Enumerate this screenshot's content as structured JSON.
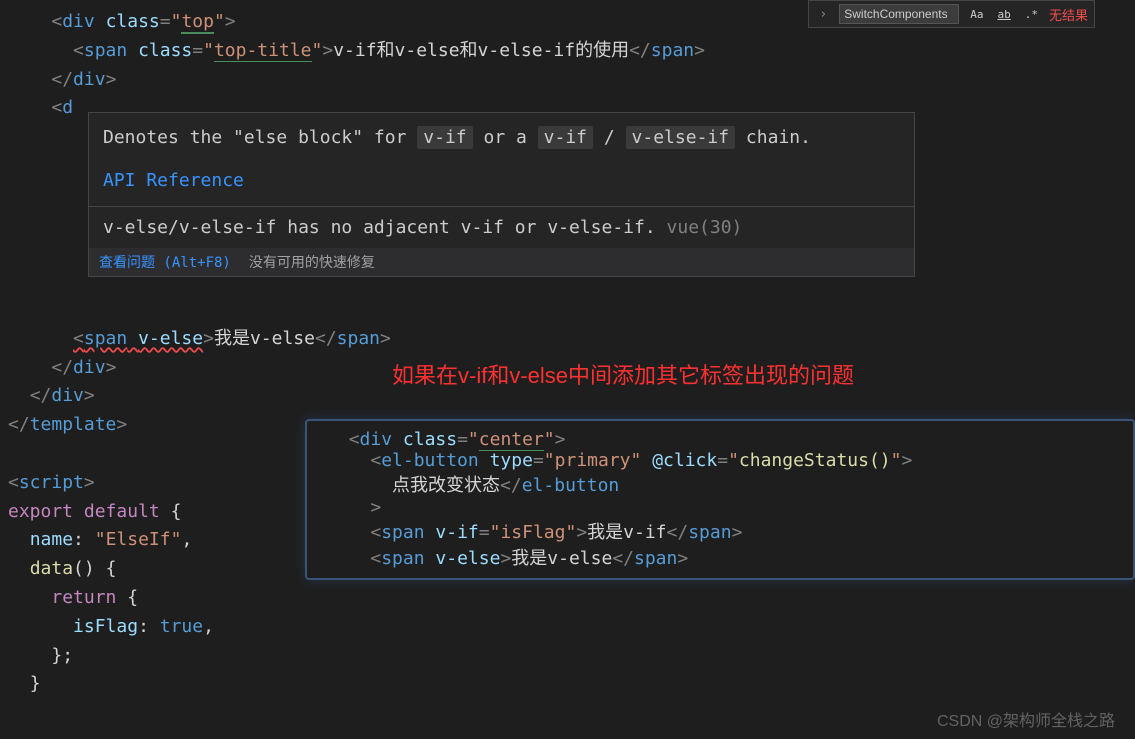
{
  "search": {
    "value": "SwitchComponents",
    "noResult": "无结果",
    "iconCase": "Aa",
    "iconWord": "ab",
    "iconRegex": ".*"
  },
  "code": {
    "l1": {
      "open": "<",
      "tag": "div",
      "attr": "class",
      "eq": "=",
      "q": "\"",
      "val": "top",
      "close": ">"
    },
    "l2": {
      "open": "<",
      "tag": "span",
      "attr": "class",
      "eq": "=",
      "q": "\"",
      "val": "top-title",
      "close": ">",
      "text": "v-if和v-else和v-else-if的使用",
      "open2": "</",
      "close2": ">"
    },
    "l3": {
      "open": "</",
      "tag": "div",
      "close": ">"
    },
    "l4": {
      "open": "<",
      "tag": "d"
    },
    "l5": {
      "open": "<",
      "tag": "span",
      "attr": "v-else",
      "close": ">",
      "text": "我是v-else",
      "open2": "</",
      "close2": ">"
    },
    "l6": {
      "open": "</",
      "tag": "div",
      "close": ">"
    },
    "l7": {
      "open": "</",
      "tag": "div",
      "close": ">"
    },
    "l8": {
      "open": "</",
      "tag": "template",
      "close": ">"
    },
    "l9": {
      "open": "<",
      "tag": "script",
      "close": ">"
    },
    "l10": {
      "kw1": "export",
      "kw2": "default",
      "brace": "{"
    },
    "l11": {
      "var": "name",
      "colon": ": ",
      "q": "\"",
      "val": "ElseIf",
      "comma": ","
    },
    "l12": {
      "fn": "data",
      "paren": "()",
      "brace": " {"
    },
    "l13": {
      "kw": "return",
      "brace": " {"
    },
    "l14": {
      "var": "isFlag",
      "colon": ": ",
      "val": "true",
      "comma": ","
    },
    "l15": {
      "close": "};"
    },
    "l16": {
      "close": "}"
    }
  },
  "hover": {
    "desc1": "Denotes the \"else block\" for ",
    "pill1": "v-if",
    "desc2": " or a ",
    "pill2": "v-if",
    "desc3": " / ",
    "pill3": "v-else-if",
    "desc4": " chain.",
    "api": "API Reference",
    "diag": "v-else/v-else-if has no adjacent v-if or v-else-if.",
    "diagCode": "vue(30)",
    "problemLink": "查看问题 (Alt+F8)",
    "quickfix": "没有可用的快速修复"
  },
  "annotation": "如果在v-if和v-else中间添加其它标签出现的问题",
  "inset": {
    "l1": {
      "open": "<",
      "tag": "div",
      "attr": "class",
      "eq": "=",
      "q": "\"",
      "val": "center",
      "close": ">"
    },
    "l2": {
      "open": "<",
      "tag": "el-button",
      "attr1": "type",
      "eq": "=",
      "q": "\"",
      "val1": "primary",
      "attr2": "@click",
      "val2": "changeStatus()",
      "close": ">"
    },
    "l3": {
      "text": "点我改变状态",
      "open": "</",
      "tag": "el-button"
    },
    "l4": {
      "close": ">"
    },
    "l5": {
      "open": "<",
      "tag": "span",
      "attr": "v-if",
      "eq": "=",
      "q": "\"",
      "val": "isFlag",
      "close": ">",
      "text": "我是v-if",
      "open2": "</",
      "close2": ">"
    },
    "l6": {
      "open": "<",
      "tag": "span",
      "attr": "v-else",
      "close": ">",
      "text": "我是v-else",
      "open2": "</",
      "close2": ">"
    }
  },
  "watermark": "CSDN @架构师全栈之路"
}
